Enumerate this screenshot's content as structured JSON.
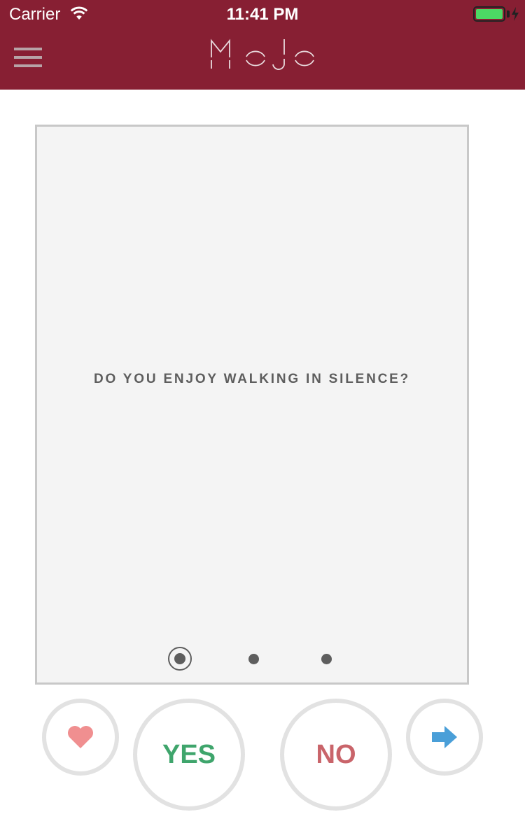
{
  "status_bar": {
    "carrier": "Carrier",
    "time": "11:41 PM",
    "wifi_icon": "wifi-icon",
    "battery_icon": "battery-icon",
    "charging_icon": "bolt-icon"
  },
  "header": {
    "logo_text": "MOJO",
    "menu_icon": "hamburger-menu-icon",
    "background_color": "#871f33"
  },
  "card": {
    "question": "DO YOU ENJOY WALKING IN SILENCE?",
    "pages": 3,
    "active_page": 1
  },
  "actions": {
    "favorite_icon": "heart-icon",
    "yes_label": "YES",
    "no_label": "NO",
    "next_icon": "arrow-right-icon",
    "yes_color": "#3fa56c",
    "no_color": "#c9646a",
    "heart_color": "#f08f90",
    "arrow_color": "#4a9fd8"
  }
}
